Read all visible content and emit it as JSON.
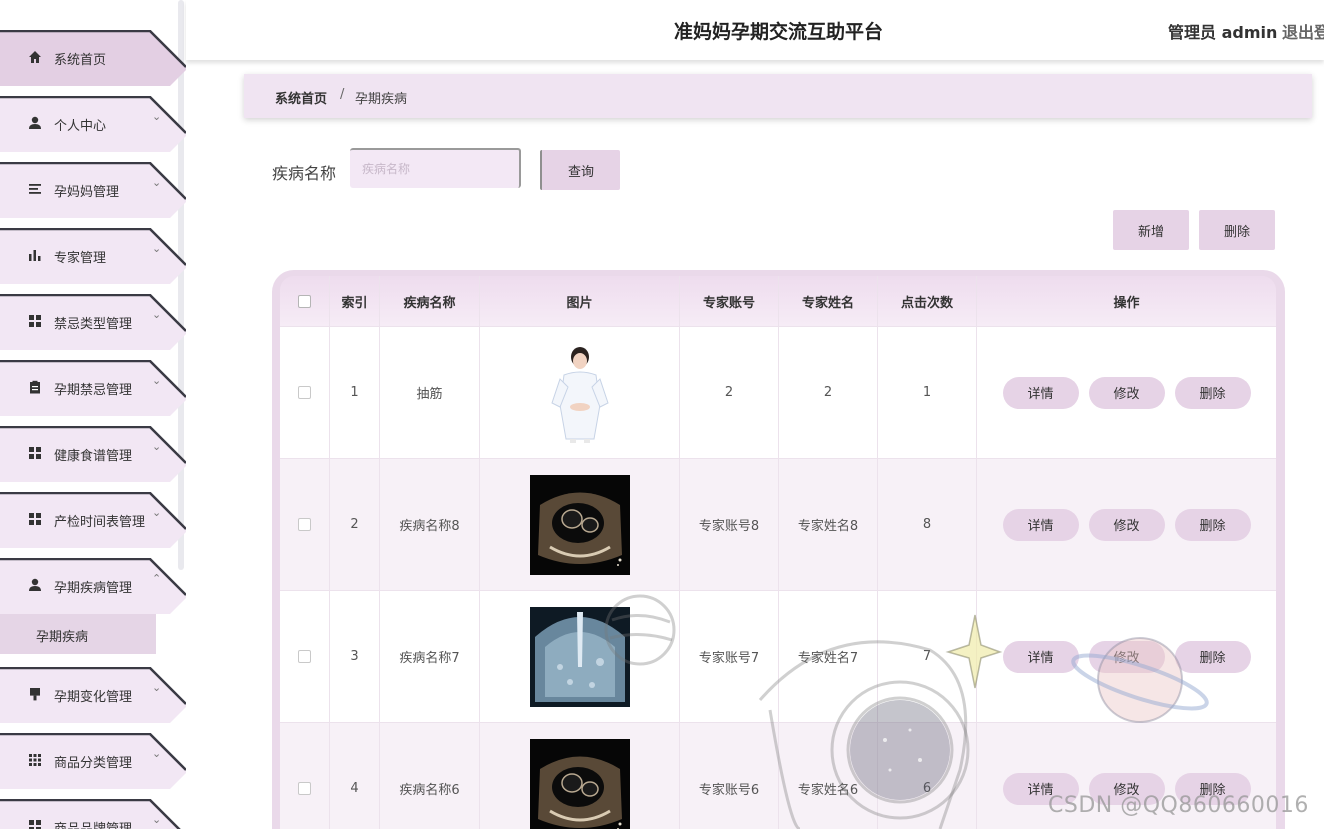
{
  "header": {
    "title": "准妈妈孕期交流互助平台",
    "admin": "管理员 admin",
    "logout": "退出登"
  },
  "sidebar": {
    "items": [
      {
        "label": "系统首页",
        "icon": "home-icon",
        "chevron": "",
        "active": true
      },
      {
        "label": "个人中心",
        "icon": "user-icon",
        "chevron": "⌄"
      },
      {
        "label": "孕妈妈管理",
        "icon": "list-icon",
        "chevron": "⌄"
      },
      {
        "label": "专家管理",
        "icon": "bar-chart-icon",
        "chevron": "⌄"
      },
      {
        "label": "禁忌类型管理",
        "icon": "grid-icon",
        "chevron": "⌄"
      },
      {
        "label": "孕期禁忌管理",
        "icon": "clipboard-icon",
        "chevron": "⌄"
      },
      {
        "label": "健康食谱管理",
        "icon": "grid-icon",
        "chevron": "⌄"
      },
      {
        "label": "产检时间表管理",
        "icon": "grid-icon",
        "chevron": "⌄"
      },
      {
        "label": "孕期疾病管理",
        "icon": "user-icon",
        "chevron": "⌃"
      },
      {
        "label": "孕期变化管理",
        "icon": "brush-icon",
        "chevron": "⌄"
      },
      {
        "label": "商品分类管理",
        "icon": "grid9-icon",
        "chevron": "⌄"
      },
      {
        "label": "商品品牌管理",
        "icon": "grid-icon",
        "chevron": "⌄"
      }
    ],
    "submenu": {
      "label": "孕期疾病"
    }
  },
  "breadcrumb": {
    "home": "系统首页",
    "separator": "/",
    "current": "孕期疾病"
  },
  "search": {
    "label": "疾病名称",
    "placeholder": "疾病名称",
    "value": "",
    "button": "查询"
  },
  "actions": {
    "add": "新增",
    "delete": "删除"
  },
  "table": {
    "columns": [
      "索引",
      "疾病名称",
      "图片",
      "专家账号",
      "专家姓名",
      "点击次数",
      "操作"
    ],
    "rows": [
      {
        "index": "1",
        "name": "抽筋",
        "image": "nurse-photo",
        "account": "2",
        "expert": "2",
        "clicks": "1"
      },
      {
        "index": "2",
        "name": "疾病名称8",
        "image": "ultrasound-image",
        "account": "专家账号8",
        "expert": "专家姓名8",
        "clicks": "8"
      },
      {
        "index": "3",
        "name": "疾病名称7",
        "image": "scan-image",
        "account": "专家账号7",
        "expert": "专家姓名7",
        "clicks": "7"
      },
      {
        "index": "4",
        "name": "疾病名称6",
        "image": "ultrasound-image",
        "account": "专家账号6",
        "expert": "专家姓名6",
        "clicks": "6"
      }
    ],
    "row_buttons": {
      "detail": "详情",
      "edit": "修改",
      "delete": "删除"
    }
  },
  "watermark": "CSDN @QQ860660016",
  "colors": {
    "accent": "#e6d3e6",
    "sidebar_item": "#f2e7f4",
    "sidebar_active": "#e3cfe3",
    "breadcrumb_bg": "#f0e4f2",
    "table_frame": "#ead9ea"
  }
}
